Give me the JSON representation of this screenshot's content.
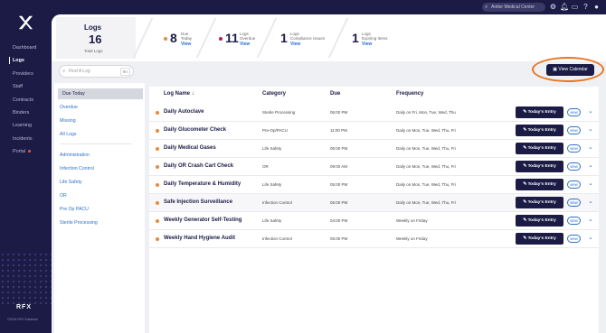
{
  "topbar": {
    "search_value": "Antler Medical Center",
    "icons": [
      "gear-icon",
      "bell-icon",
      "chat-icon",
      "help-icon",
      "user-icon"
    ]
  },
  "sidebar": {
    "brand": "RFX",
    "copyright": "©2024 RFX Solutions",
    "items": [
      {
        "label": "Dashboard"
      },
      {
        "label": "Logs"
      },
      {
        "label": "Providers"
      },
      {
        "label": "Staff"
      },
      {
        "label": "Contracts"
      },
      {
        "label": "Binders"
      },
      {
        "label": "Learning"
      },
      {
        "label": "Incidents"
      },
      {
        "label": "Portal"
      }
    ],
    "active": "Logs"
  },
  "summary": {
    "title": "Logs",
    "count": "16",
    "sub": "Total Logs",
    "stats": [
      {
        "num": "8",
        "label1": "Due",
        "label2": "Today",
        "view": "View",
        "color": "#e98a3a"
      },
      {
        "num": "11",
        "label1": "Logs",
        "label2": "Overdue",
        "view": "View",
        "color": "#c2185b"
      },
      {
        "num": "1",
        "label1": "Logs",
        "label2": "Compliance Issues",
        "view": "View",
        "color": ""
      },
      {
        "num": "1",
        "label1": "Logs",
        "label2": "Expiring Items",
        "view": "View",
        "color": ""
      }
    ]
  },
  "actions": {
    "view_calendar": "View Calendar"
  },
  "search": {
    "placeholder": "Find A Log",
    "shortcut": "⌘K"
  },
  "filters": {
    "status": [
      "Due Today",
      "Overdue",
      "Missing",
      "All Logs"
    ],
    "selected": "Due Today",
    "categories": [
      "Administration",
      "Infection Control",
      "Life Safety",
      "OR",
      "Pre Op PACU",
      "Sterile Processing"
    ]
  },
  "table": {
    "headers": {
      "name": "Log Name",
      "category": "Category",
      "due": "Due",
      "frequency": "Frequency"
    },
    "entry_label": "Today's Entry",
    "view_label": "view",
    "rows": [
      {
        "name": "Daily Autoclave",
        "category": "Sterile Processing",
        "due": "06:00 PM",
        "frequency": "Daily on Fri, Mon, Tue, Wed, Thu"
      },
      {
        "name": "Daily Glucometer Check",
        "category": "Pre-Op/PACU",
        "due": "11:00 PM",
        "frequency": "Daily on Mon, Tue, Wed, Thu, Fri"
      },
      {
        "name": "Daily Medical Gases",
        "category": "Life Safety",
        "due": "05:00 PM",
        "frequency": "Daily on Mon, Tue, Wed, Thu, Fri"
      },
      {
        "name": "Daily OR Crash Cart Check",
        "category": "OR",
        "due": "09:00 AM",
        "frequency": "Daily on Mon, Tue, Wed, Thu, Fri"
      },
      {
        "name": "Daily Temperature & Humidity",
        "category": "Life Safety",
        "due": "05:00 PM",
        "frequency": "Daily on Mon, Tue, Wed, Thu, Fri"
      },
      {
        "name": "Safe Injection Surveillance",
        "category": "Infection Control",
        "due": "05:00 PM",
        "frequency": "Daily on Mon, Tue, Wed, Thu, Fri"
      },
      {
        "name": "Weekly Generator Self-Testing",
        "category": "Life Safety",
        "due": "04:00 PM",
        "frequency": "Weekly on Friday"
      },
      {
        "name": "Weekly Hand Hygiene Audit",
        "category": "Infection Control",
        "due": "05:00 PM",
        "frequency": "Weekly on Friday"
      }
    ]
  }
}
